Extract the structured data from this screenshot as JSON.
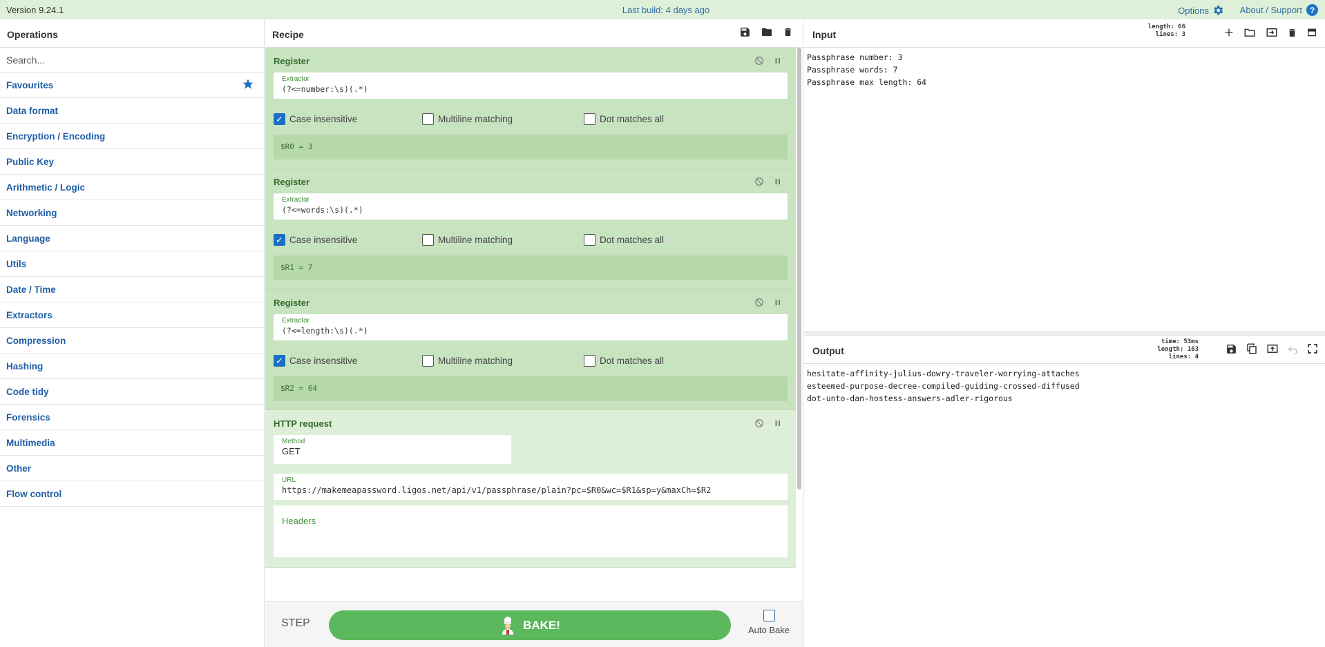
{
  "topbar": {
    "version": "Version 9.24.1",
    "build": "Last build: 4 days ago",
    "options": "Options",
    "about": "About / Support",
    "about_icon_glyph": "?"
  },
  "operations": {
    "title": "Operations",
    "search_placeholder": "Search...",
    "categories": [
      "Favourites",
      "Data format",
      "Encryption / Encoding",
      "Public Key",
      "Arithmetic / Logic",
      "Networking",
      "Language",
      "Utils",
      "Date / Time",
      "Extractors",
      "Compression",
      "Hashing",
      "Code tidy",
      "Forensics",
      "Multimedia",
      "Other",
      "Flow control"
    ]
  },
  "recipe": {
    "title": "Recipe",
    "ops": [
      {
        "name": "Register",
        "field_label": "Extractor",
        "field_value": "(?<=number:\\s)(.*)",
        "opt1": "Case insensitive",
        "opt2": "Multiline matching",
        "opt3": "Dot matches all",
        "result": "$R0 = 3"
      },
      {
        "name": "Register",
        "field_label": "Extractor",
        "field_value": "(?<=words:\\s)(.*)",
        "opt1": "Case insensitive",
        "opt2": "Multiline matching",
        "opt3": "Dot matches all",
        "result": "$R1 = 7"
      },
      {
        "name": "Register",
        "field_label": "Extractor",
        "field_value": "(?<=length:\\s)(.*)",
        "opt1": "Case insensitive",
        "opt2": "Multiline matching",
        "opt3": "Dot matches all",
        "result": "$R2 = 64"
      }
    ],
    "http": {
      "name": "HTTP request",
      "method_label": "Method",
      "method_value": "GET",
      "url_label": "URL",
      "url_value": "https://makemeapassword.ligos.net/api/v1/passphrase/plain?pc=$R0&wc=$R1&sp=y&maxCh=$R2",
      "headers_label": "Headers"
    },
    "step": "STEP",
    "bake": "BAKE!",
    "auto_bake": "Auto Bake"
  },
  "input": {
    "title": "Input",
    "stat_length": "length:  66",
    "stat_lines": "lines:   3",
    "text": "Passphrase number: 3\nPassphrase words: 7\nPassphrase max length: 64"
  },
  "output": {
    "title": "Output",
    "stat_time": "time:  53ms",
    "stat_length": "length:  163",
    "stat_lines": "lines:    4",
    "text": "hesitate-affinity-julius-dowry-traveler-worrying-attaches\nesteemed-purpose-decree-compiled-guiding-crossed-diffused\ndot-unto-dan-hostess-answers-adler-rigorous"
  },
  "colors": {
    "accent_blue": "#1a6fc4",
    "bake_green": "#5cb85c",
    "op_green": "#c7e3bf"
  }
}
